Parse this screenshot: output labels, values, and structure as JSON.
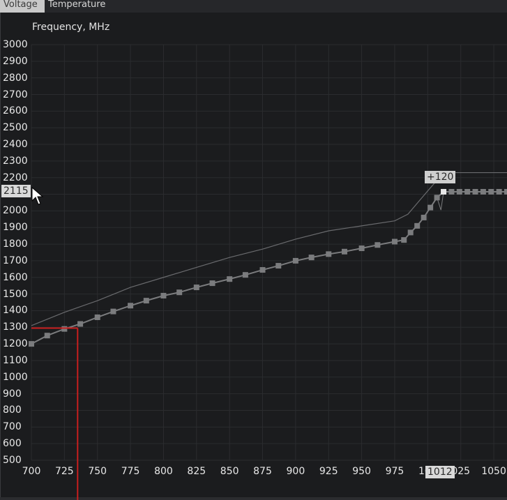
{
  "tabs": [
    {
      "label": "Voltage",
      "active": true
    },
    {
      "label": "Temperature",
      "active": false
    }
  ],
  "chart_data": {
    "type": "line",
    "ylabel": "Frequency, MHz",
    "xlim": [
      700,
      1060
    ],
    "ylim": [
      500,
      3000
    ],
    "yticks": [
      3000,
      2900,
      2800,
      2700,
      2600,
      2500,
      2400,
      2300,
      2200,
      2100,
      2000,
      1900,
      1800,
      1700,
      1600,
      1500,
      1400,
      1300,
      1200,
      1100,
      1000,
      900,
      800,
      700,
      600,
      500
    ],
    "xticks": [
      "700",
      "725",
      "750",
      "775",
      "800",
      "825",
      "850",
      "875",
      "900",
      "925",
      "950",
      "975",
      "100",
      "1012",
      "025",
      "1050"
    ],
    "grid": true,
    "series": [
      {
        "role": "default-curve",
        "color": "#6a6b6e",
        "x": [
          700,
          725,
          750,
          775,
          800,
          825,
          850,
          875,
          900,
          925,
          950,
          975,
          985,
          1000,
          1012,
          1020,
          1060
        ],
        "y": [
          1310,
          1390,
          1460,
          1540,
          1600,
          1660,
          1720,
          1770,
          1830,
          1880,
          1910,
          1940,
          1980,
          2120,
          2230,
          2230,
          2230
        ]
      },
      {
        "role": "voltage-frequency-points",
        "color": "#7b7c7e",
        "x": [
          700,
          712,
          725,
          737,
          750,
          762,
          775,
          787,
          800,
          812,
          825,
          837,
          850,
          862,
          875,
          887,
          900,
          912,
          925,
          937,
          950,
          962,
          975,
          982,
          987,
          992,
          997,
          1002,
          1007,
          1012,
          1018,
          1024,
          1030,
          1036,
          1042,
          1048,
          1054,
          1060
        ],
        "y": [
          1200,
          1250,
          1290,
          1320,
          1360,
          1395,
          1430,
          1460,
          1490,
          1510,
          1540,
          1565,
          1590,
          1615,
          1645,
          1670,
          1700,
          1720,
          1740,
          1755,
          1775,
          1795,
          1815,
          1825,
          1870,
          1910,
          1960,
          2020,
          2080,
          2115,
          2115,
          2115,
          2115,
          2115,
          2115,
          2115,
          2115,
          2115
        ]
      }
    ],
    "highlight": {
      "x": 1012,
      "y": 2115
    },
    "selection": {
      "voltage": 735,
      "frequency": 1295
    }
  },
  "labels": {
    "y_marker": "2115",
    "x_marker": "1012",
    "offset": "+120"
  },
  "colors": {
    "background": "#1b1c1e",
    "grid": "#2b2c2f",
    "selection": "#c81e1e"
  }
}
